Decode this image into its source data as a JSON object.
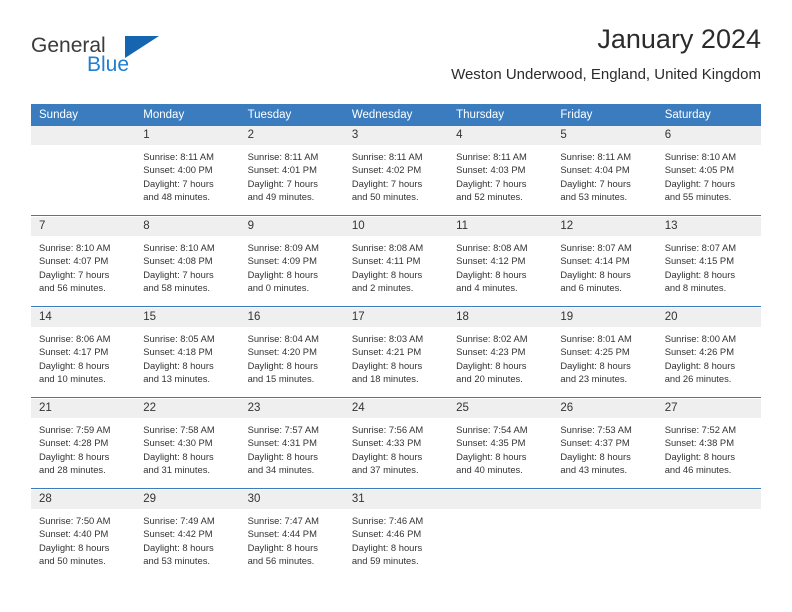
{
  "brand": {
    "name_part1": "General",
    "name_part2": "Blue"
  },
  "header": {
    "title": "January 2024",
    "subtitle": "Weston Underwood, England, United Kingdom"
  },
  "colors": {
    "header_blue": "#3a7cbe",
    "logo_blue": "#1f7fd0",
    "date_band": "#efefef"
  },
  "weekday_headers": [
    "Sunday",
    "Monday",
    "Tuesday",
    "Wednesday",
    "Thursday",
    "Friday",
    "Saturday"
  ],
  "weeks": [
    [
      {
        "date": "",
        "sunrise": "",
        "sunset": "",
        "daylight_line1": "",
        "daylight_line2": ""
      },
      {
        "date": "1",
        "sunrise": "Sunrise: 8:11 AM",
        "sunset": "Sunset: 4:00 PM",
        "daylight_line1": "Daylight: 7 hours",
        "daylight_line2": "and 48 minutes."
      },
      {
        "date": "2",
        "sunrise": "Sunrise: 8:11 AM",
        "sunset": "Sunset: 4:01 PM",
        "daylight_line1": "Daylight: 7 hours",
        "daylight_line2": "and 49 minutes."
      },
      {
        "date": "3",
        "sunrise": "Sunrise: 8:11 AM",
        "sunset": "Sunset: 4:02 PM",
        "daylight_line1": "Daylight: 7 hours",
        "daylight_line2": "and 50 minutes."
      },
      {
        "date": "4",
        "sunrise": "Sunrise: 8:11 AM",
        "sunset": "Sunset: 4:03 PM",
        "daylight_line1": "Daylight: 7 hours",
        "daylight_line2": "and 52 minutes."
      },
      {
        "date": "5",
        "sunrise": "Sunrise: 8:11 AM",
        "sunset": "Sunset: 4:04 PM",
        "daylight_line1": "Daylight: 7 hours",
        "daylight_line2": "and 53 minutes."
      },
      {
        "date": "6",
        "sunrise": "Sunrise: 8:10 AM",
        "sunset": "Sunset: 4:05 PM",
        "daylight_line1": "Daylight: 7 hours",
        "daylight_line2": "and 55 minutes."
      }
    ],
    [
      {
        "date": "7",
        "sunrise": "Sunrise: 8:10 AM",
        "sunset": "Sunset: 4:07 PM",
        "daylight_line1": "Daylight: 7 hours",
        "daylight_line2": "and 56 minutes."
      },
      {
        "date": "8",
        "sunrise": "Sunrise: 8:10 AM",
        "sunset": "Sunset: 4:08 PM",
        "daylight_line1": "Daylight: 7 hours",
        "daylight_line2": "and 58 minutes."
      },
      {
        "date": "9",
        "sunrise": "Sunrise: 8:09 AM",
        "sunset": "Sunset: 4:09 PM",
        "daylight_line1": "Daylight: 8 hours",
        "daylight_line2": "and 0 minutes."
      },
      {
        "date": "10",
        "sunrise": "Sunrise: 8:08 AM",
        "sunset": "Sunset: 4:11 PM",
        "daylight_line1": "Daylight: 8 hours",
        "daylight_line2": "and 2 minutes."
      },
      {
        "date": "11",
        "sunrise": "Sunrise: 8:08 AM",
        "sunset": "Sunset: 4:12 PM",
        "daylight_line1": "Daylight: 8 hours",
        "daylight_line2": "and 4 minutes."
      },
      {
        "date": "12",
        "sunrise": "Sunrise: 8:07 AM",
        "sunset": "Sunset: 4:14 PM",
        "daylight_line1": "Daylight: 8 hours",
        "daylight_line2": "and 6 minutes."
      },
      {
        "date": "13",
        "sunrise": "Sunrise: 8:07 AM",
        "sunset": "Sunset: 4:15 PM",
        "daylight_line1": "Daylight: 8 hours",
        "daylight_line2": "and 8 minutes."
      }
    ],
    [
      {
        "date": "14",
        "sunrise": "Sunrise: 8:06 AM",
        "sunset": "Sunset: 4:17 PM",
        "daylight_line1": "Daylight: 8 hours",
        "daylight_line2": "and 10 minutes."
      },
      {
        "date": "15",
        "sunrise": "Sunrise: 8:05 AM",
        "sunset": "Sunset: 4:18 PM",
        "daylight_line1": "Daylight: 8 hours",
        "daylight_line2": "and 13 minutes."
      },
      {
        "date": "16",
        "sunrise": "Sunrise: 8:04 AM",
        "sunset": "Sunset: 4:20 PM",
        "daylight_line1": "Daylight: 8 hours",
        "daylight_line2": "and 15 minutes."
      },
      {
        "date": "17",
        "sunrise": "Sunrise: 8:03 AM",
        "sunset": "Sunset: 4:21 PM",
        "daylight_line1": "Daylight: 8 hours",
        "daylight_line2": "and 18 minutes."
      },
      {
        "date": "18",
        "sunrise": "Sunrise: 8:02 AM",
        "sunset": "Sunset: 4:23 PM",
        "daylight_line1": "Daylight: 8 hours",
        "daylight_line2": "and 20 minutes."
      },
      {
        "date": "19",
        "sunrise": "Sunrise: 8:01 AM",
        "sunset": "Sunset: 4:25 PM",
        "daylight_line1": "Daylight: 8 hours",
        "daylight_line2": "and 23 minutes."
      },
      {
        "date": "20",
        "sunrise": "Sunrise: 8:00 AM",
        "sunset": "Sunset: 4:26 PM",
        "daylight_line1": "Daylight: 8 hours",
        "daylight_line2": "and 26 minutes."
      }
    ],
    [
      {
        "date": "21",
        "sunrise": "Sunrise: 7:59 AM",
        "sunset": "Sunset: 4:28 PM",
        "daylight_line1": "Daylight: 8 hours",
        "daylight_line2": "and 28 minutes."
      },
      {
        "date": "22",
        "sunrise": "Sunrise: 7:58 AM",
        "sunset": "Sunset: 4:30 PM",
        "daylight_line1": "Daylight: 8 hours",
        "daylight_line2": "and 31 minutes."
      },
      {
        "date": "23",
        "sunrise": "Sunrise: 7:57 AM",
        "sunset": "Sunset: 4:31 PM",
        "daylight_line1": "Daylight: 8 hours",
        "daylight_line2": "and 34 minutes."
      },
      {
        "date": "24",
        "sunrise": "Sunrise: 7:56 AM",
        "sunset": "Sunset: 4:33 PM",
        "daylight_line1": "Daylight: 8 hours",
        "daylight_line2": "and 37 minutes."
      },
      {
        "date": "25",
        "sunrise": "Sunrise: 7:54 AM",
        "sunset": "Sunset: 4:35 PM",
        "daylight_line1": "Daylight: 8 hours",
        "daylight_line2": "and 40 minutes."
      },
      {
        "date": "26",
        "sunrise": "Sunrise: 7:53 AM",
        "sunset": "Sunset: 4:37 PM",
        "daylight_line1": "Daylight: 8 hours",
        "daylight_line2": "and 43 minutes."
      },
      {
        "date": "27",
        "sunrise": "Sunrise: 7:52 AM",
        "sunset": "Sunset: 4:38 PM",
        "daylight_line1": "Daylight: 8 hours",
        "daylight_line2": "and 46 minutes."
      }
    ],
    [
      {
        "date": "28",
        "sunrise": "Sunrise: 7:50 AM",
        "sunset": "Sunset: 4:40 PM",
        "daylight_line1": "Daylight: 8 hours",
        "daylight_line2": "and 50 minutes."
      },
      {
        "date": "29",
        "sunrise": "Sunrise: 7:49 AM",
        "sunset": "Sunset: 4:42 PM",
        "daylight_line1": "Daylight: 8 hours",
        "daylight_line2": "and 53 minutes."
      },
      {
        "date": "30",
        "sunrise": "Sunrise: 7:47 AM",
        "sunset": "Sunset: 4:44 PM",
        "daylight_line1": "Daylight: 8 hours",
        "daylight_line2": "and 56 minutes."
      },
      {
        "date": "31",
        "sunrise": "Sunrise: 7:46 AM",
        "sunset": "Sunset: 4:46 PM",
        "daylight_line1": "Daylight: 8 hours",
        "daylight_line2": "and 59 minutes."
      },
      {
        "date": "",
        "sunrise": "",
        "sunset": "",
        "daylight_line1": "",
        "daylight_line2": ""
      },
      {
        "date": "",
        "sunrise": "",
        "sunset": "",
        "daylight_line1": "",
        "daylight_line2": ""
      },
      {
        "date": "",
        "sunrise": "",
        "sunset": "",
        "daylight_line1": "",
        "daylight_line2": ""
      }
    ]
  ]
}
